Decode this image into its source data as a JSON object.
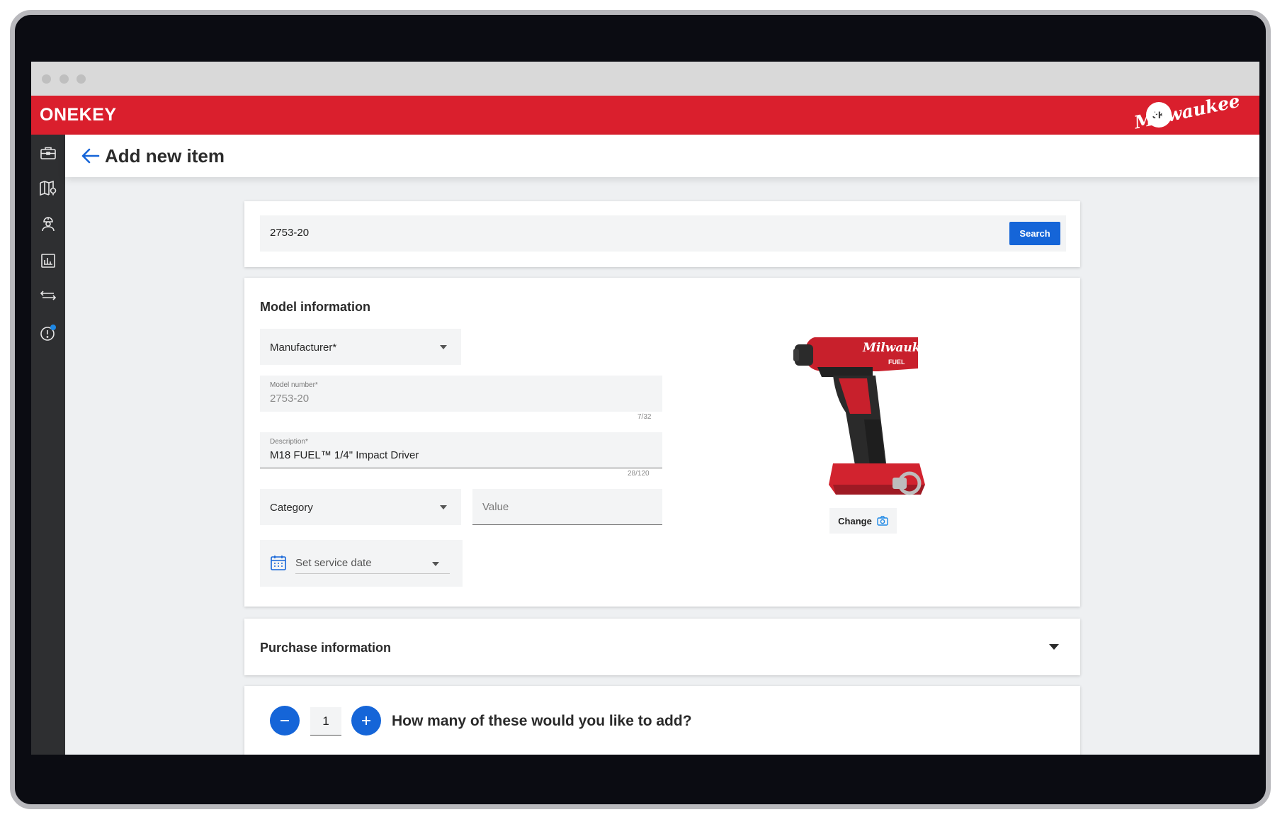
{
  "app": {
    "logo": "ONEKEY",
    "brand": "Milwaukee",
    "user_initials": "JK"
  },
  "sidebar": {
    "items": [
      {
        "name": "toolbox",
        "icon": "briefcase-icon"
      },
      {
        "name": "map",
        "icon": "map-pin-icon"
      },
      {
        "name": "people",
        "icon": "worker-icon"
      },
      {
        "name": "reports",
        "icon": "bar-chart-icon"
      },
      {
        "name": "transfers",
        "icon": "transfer-arrows-icon"
      },
      {
        "name": "alerts",
        "icon": "alert-icon",
        "badge_color": "#1e88e5"
      }
    ]
  },
  "page": {
    "title": "Add new item"
  },
  "search": {
    "value": "2753-20",
    "button_label": "Search"
  },
  "model_info": {
    "title": "Model information",
    "manufacturer_label": "Manufacturer*",
    "model_number_label": "Model number*",
    "model_number_value": "2753-20",
    "model_number_counter": "7/32",
    "description_label": "Description*",
    "description_value": "M18 FUEL™ 1/4\" Impact Driver",
    "description_counter": "28/120",
    "category_label": "Category",
    "value_placeholder": "Value",
    "service_date_label": "Set service date",
    "change_label": "Change"
  },
  "purchase": {
    "title": "Purchase information"
  },
  "quantity": {
    "value": "1",
    "question": "How many of these would you like to add?"
  },
  "colors": {
    "brand_red": "#da1f2d",
    "accent_blue": "#1565d8",
    "sidebar": "#2e2f31"
  }
}
